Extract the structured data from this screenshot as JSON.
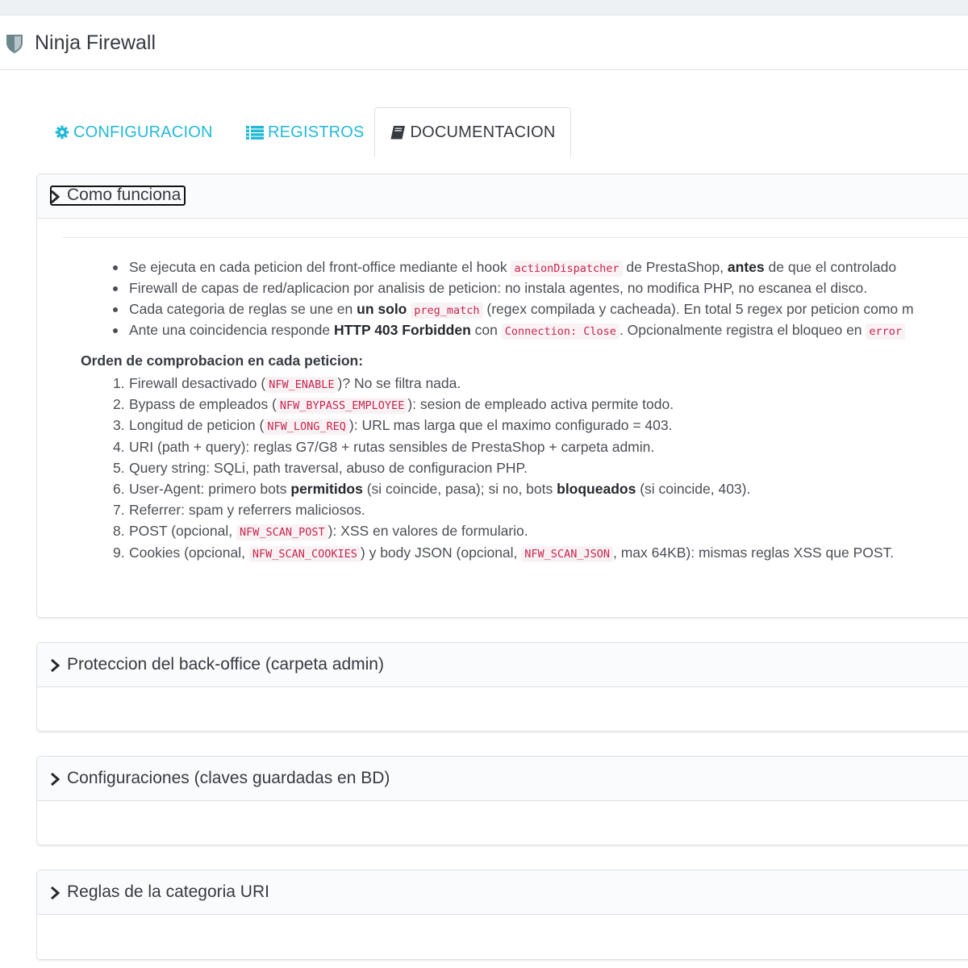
{
  "header": {
    "title": "Ninja Firewall",
    "icon": "shield-icon"
  },
  "tabs": [
    {
      "label": "CONFIGURACION",
      "icon": "gear-icon",
      "active": false
    },
    {
      "label": "REGISTROS",
      "icon": "list-icon",
      "active": false
    },
    {
      "label": "DOCUMENTACION",
      "icon": "book-icon",
      "active": true
    }
  ],
  "colors": {
    "accent": "#25b9d7",
    "code": "#c7254e",
    "code_bg": "#f9f2f4",
    "text": "#363a41"
  },
  "panels": [
    {
      "title": "Como funciona",
      "expanded": true
    },
    {
      "title": "Proteccion del back-office (carpeta admin)",
      "expanded": false
    },
    {
      "title": "Configuraciones (claves guardadas en BD)",
      "expanded": false
    },
    {
      "title": "Reglas de la categoria URI",
      "expanded": false
    }
  ],
  "how": {
    "b1": {
      "t1": "Se ejecuta en cada peticion del front-office mediante el hook",
      "c1": "actionDispatcher",
      "t2": "de PrestaShop,",
      "s1": "antes",
      "t3": "de que el controlado"
    },
    "b2": {
      "t1": "Firewall de capas de red/aplicacion por analisis de peticion: no instala agentes, no modifica PHP, no escanea el disco."
    },
    "b3": {
      "t1": "Cada categoria de reglas se une en",
      "s1": "un solo",
      "c1": "preg_match",
      "t2": "(regex compilada y cacheada). En total 5 regex por peticion como m"
    },
    "b4": {
      "t1": "Ante una coincidencia responde",
      "s1": "HTTP 403 Forbidden",
      "t2": "con",
      "c1": "Connection: Close",
      "t3": ". Opcionalmente registra el bloqueo en",
      "c2": "error"
    },
    "order_title": "Orden de comprobacion en cada peticion:",
    "o1": {
      "n": "1.",
      "t1": "Firewall desactivado (",
      "c1": "NFW_ENABLE",
      "t2": ")? No se filtra nada."
    },
    "o2": {
      "n": "2.",
      "t1": "Bypass de empleados (",
      "c1": "NFW_BYPASS_EMPLOYEE",
      "t2": "): sesion de empleado activa permite todo."
    },
    "o3": {
      "n": "3.",
      "t1": "Longitud de peticion (",
      "c1": "NFW_LONG_REQ",
      "t2": "): URL mas larga que el maximo configurado = 403."
    },
    "o4": {
      "n": "4.",
      "t1": "URI (path + query): reglas G7/G8 + rutas sensibles de PrestaShop + carpeta admin."
    },
    "o5": {
      "n": "5.",
      "t1": "Query string: SQLi, path traversal, abuso de configuracion PHP."
    },
    "o6": {
      "n": "6.",
      "t1": "User-Agent: primero bots",
      "s1": "permitidos",
      "t2": "(si coincide, pasa); si no, bots",
      "s2": "bloqueados",
      "t3": "(si coincide, 403)."
    },
    "o7": {
      "n": "7.",
      "t1": "Referrer: spam y referrers maliciosos."
    },
    "o8": {
      "n": "8.",
      "t1": "POST (opcional,",
      "c1": "NFW_SCAN_POST",
      "t2": "): XSS en valores de formulario."
    },
    "o9": {
      "n": "9.",
      "t1": "Cookies (opcional,",
      "c1": "NFW_SCAN_COOKIES",
      "t2": ") y body JSON (opcional,",
      "c2": "NFW_SCAN_JSON",
      "t3": ", max 64KB): mismas reglas XSS que POST."
    }
  }
}
